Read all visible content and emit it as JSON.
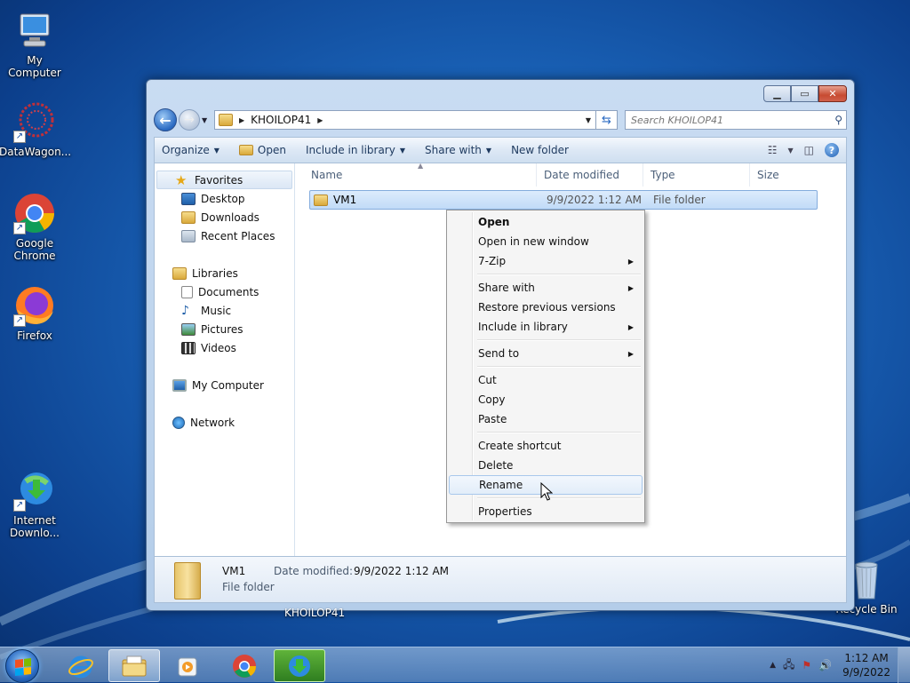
{
  "desktop": {
    "icons": [
      {
        "label": "My Computer"
      },
      {
        "label": "DataWagon..."
      },
      {
        "label": "Google Chrome"
      },
      {
        "label": "Firefox"
      },
      {
        "label": "Internet Downlo..."
      },
      {
        "label": "Recycle Bin"
      }
    ],
    "window_label": "KHOILOP41"
  },
  "explorer": {
    "address": {
      "crumb": "KHOILOP41"
    },
    "search": {
      "placeholder": "Search KHOILOP41"
    },
    "toolbar": {
      "organize": "Organize",
      "open": "Open",
      "include_in_library": "Include in library",
      "share_with": "Share with",
      "new_folder": "New folder"
    },
    "nav": {
      "favorites": "Favorites",
      "desktop": "Desktop",
      "downloads": "Downloads",
      "recent_places": "Recent Places",
      "libraries": "Libraries",
      "documents": "Documents",
      "music": "Music",
      "pictures": "Pictures",
      "videos": "Videos",
      "my_computer": "My Computer",
      "network": "Network"
    },
    "columns": {
      "name": "Name",
      "date_modified": "Date modified",
      "type": "Type",
      "size": "Size"
    },
    "files": [
      {
        "name": "VM1",
        "date_modified": "9/9/2022 1:12 AM",
        "type": "File folder",
        "size": ""
      }
    ],
    "details": {
      "name": "VM1",
      "type": "File folder",
      "date_modified_label": "Date modified:",
      "date_modified_value": "9/9/2022 1:12 AM"
    }
  },
  "context_menu": {
    "items": [
      {
        "label": "Open"
      },
      {
        "label": "Open in new window"
      },
      {
        "label": "7-Zip"
      },
      {
        "label": "Share with"
      },
      {
        "label": "Restore previous versions"
      },
      {
        "label": "Include in library"
      },
      {
        "label": "Send to"
      },
      {
        "label": "Cut"
      },
      {
        "label": "Copy"
      },
      {
        "label": "Paste"
      },
      {
        "label": "Create shortcut"
      },
      {
        "label": "Delete"
      },
      {
        "label": "Rename"
      },
      {
        "label": "Properties"
      }
    ]
  },
  "taskbar": {
    "clock_time": "1:12 AM",
    "clock_date": "9/9/2022"
  }
}
